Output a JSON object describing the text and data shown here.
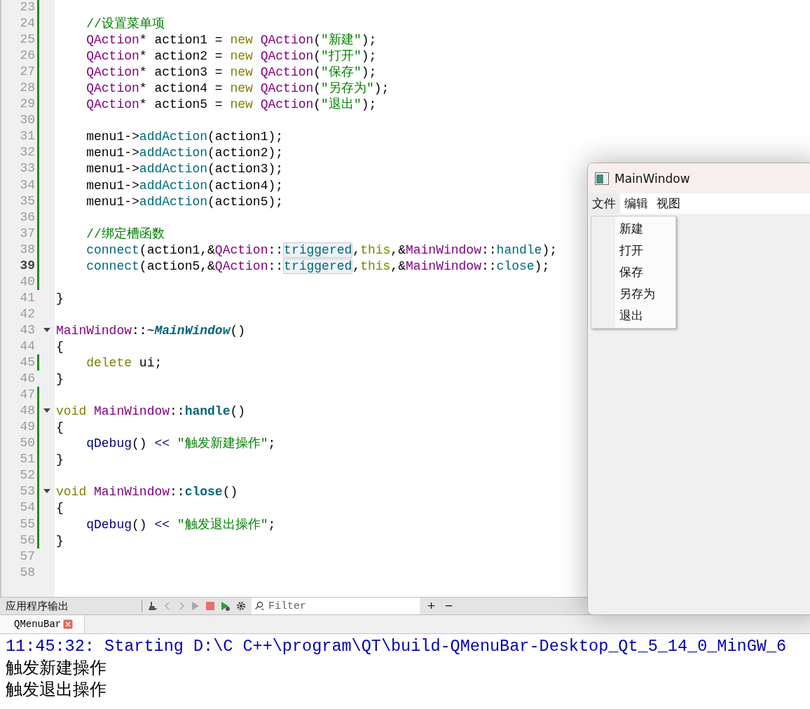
{
  "editor": {
    "lines": [
      {
        "number": "23",
        "changed": true,
        "fold": false,
        "current": false
      },
      {
        "number": "24",
        "changed": true,
        "fold": false,
        "current": false,
        "tokens": [
          {
            "kind": "comment",
            "text": "    //设置菜单项"
          }
        ]
      },
      {
        "number": "25",
        "changed": true,
        "fold": false,
        "current": false,
        "tokens": [
          {
            "kind": "type",
            "text": "    QAction"
          },
          {
            "kind": "plain",
            "text": "* action1 = "
          },
          {
            "kind": "keyword",
            "text": "new "
          },
          {
            "kind": "type",
            "text": "QAction"
          },
          {
            "kind": "plain",
            "text": "("
          },
          {
            "kind": "string",
            "text": "\"新建\""
          },
          {
            "kind": "plain",
            "text": ");"
          }
        ]
      },
      {
        "number": "26",
        "changed": true,
        "fold": false,
        "current": false,
        "tokens": [
          {
            "kind": "type",
            "text": "    QAction"
          },
          {
            "kind": "plain",
            "text": "* action2 = "
          },
          {
            "kind": "keyword",
            "text": "new "
          },
          {
            "kind": "type",
            "text": "QAction"
          },
          {
            "kind": "plain",
            "text": "("
          },
          {
            "kind": "string",
            "text": "\"打开\""
          },
          {
            "kind": "plain",
            "text": ");"
          }
        ]
      },
      {
        "number": "27",
        "changed": true,
        "fold": false,
        "current": false,
        "tokens": [
          {
            "kind": "type",
            "text": "    QAction"
          },
          {
            "kind": "plain",
            "text": "* action3 = "
          },
          {
            "kind": "keyword",
            "text": "new "
          },
          {
            "kind": "type",
            "text": "QAction"
          },
          {
            "kind": "plain",
            "text": "("
          },
          {
            "kind": "string",
            "text": "\"保存\""
          },
          {
            "kind": "plain",
            "text": ");"
          }
        ]
      },
      {
        "number": "28",
        "changed": true,
        "fold": false,
        "current": false,
        "tokens": [
          {
            "kind": "type",
            "text": "    QAction"
          },
          {
            "kind": "plain",
            "text": "* action4 = "
          },
          {
            "kind": "keyword",
            "text": "new "
          },
          {
            "kind": "type",
            "text": "QAction"
          },
          {
            "kind": "plain",
            "text": "("
          },
          {
            "kind": "string",
            "text": "\"另存为\""
          },
          {
            "kind": "plain",
            "text": ");"
          }
        ]
      },
      {
        "number": "29",
        "changed": true,
        "fold": false,
        "current": false,
        "tokens": [
          {
            "kind": "type",
            "text": "    QAction"
          },
          {
            "kind": "plain",
            "text": "* action5 = "
          },
          {
            "kind": "keyword",
            "text": "new "
          },
          {
            "kind": "type",
            "text": "QAction"
          },
          {
            "kind": "plain",
            "text": "("
          },
          {
            "kind": "string",
            "text": "\"退出\""
          },
          {
            "kind": "plain",
            "text": ");"
          }
        ]
      },
      {
        "number": "30",
        "changed": true,
        "fold": false,
        "current": false
      },
      {
        "number": "31",
        "changed": true,
        "fold": false,
        "current": false,
        "tokens": [
          {
            "kind": "plain",
            "text": "    menu1->"
          },
          {
            "kind": "function",
            "text": "addAction"
          },
          {
            "kind": "plain",
            "text": "(action1);"
          }
        ]
      },
      {
        "number": "32",
        "changed": true,
        "fold": false,
        "current": false,
        "tokens": [
          {
            "kind": "plain",
            "text": "    menu1->"
          },
          {
            "kind": "function",
            "text": "addAction"
          },
          {
            "kind": "plain",
            "text": "(action2);"
          }
        ]
      },
      {
        "number": "33",
        "changed": true,
        "fold": false,
        "current": false,
        "tokens": [
          {
            "kind": "plain",
            "text": "    menu1->"
          },
          {
            "kind": "function",
            "text": "addAction"
          },
          {
            "kind": "plain",
            "text": "(action3);"
          }
        ]
      },
      {
        "number": "34",
        "changed": true,
        "fold": false,
        "current": false,
        "tokens": [
          {
            "kind": "plain",
            "text": "    menu1->"
          },
          {
            "kind": "function",
            "text": "addAction"
          },
          {
            "kind": "plain",
            "text": "(action4);"
          }
        ]
      },
      {
        "number": "35",
        "changed": true,
        "fold": false,
        "current": false,
        "tokens": [
          {
            "kind": "plain",
            "text": "    menu1->"
          },
          {
            "kind": "function",
            "text": "addAction"
          },
          {
            "kind": "plain",
            "text": "(action5);"
          }
        ]
      },
      {
        "number": "36",
        "changed": true,
        "fold": false,
        "current": false
      },
      {
        "number": "37",
        "changed": true,
        "fold": false,
        "current": false,
        "tokens": [
          {
            "kind": "comment",
            "text": "    //绑定槽函数"
          }
        ]
      },
      {
        "number": "38",
        "changed": true,
        "fold": false,
        "current": false,
        "tokens": [
          {
            "kind": "function",
            "text": "    connect"
          },
          {
            "kind": "plain",
            "text": "(action1,&"
          },
          {
            "kind": "type",
            "text": "QAction"
          },
          {
            "kind": "plain",
            "text": "::"
          },
          {
            "kind": "highlight",
            "text": "triggered"
          },
          {
            "kind": "plain",
            "text": ","
          },
          {
            "kind": "keyword",
            "text": "this"
          },
          {
            "kind": "plain",
            "text": ",&"
          },
          {
            "kind": "type",
            "text": "MainWindow"
          },
          {
            "kind": "plain",
            "text": "::"
          },
          {
            "kind": "function",
            "text": "handle"
          },
          {
            "kind": "plain",
            "text": ");"
          }
        ]
      },
      {
        "number": "39",
        "changed": true,
        "fold": false,
        "current": true,
        "tokens": [
          {
            "kind": "function",
            "text": "    connect"
          },
          {
            "kind": "plain",
            "text": "(action5,&"
          },
          {
            "kind": "type",
            "text": "QAction"
          },
          {
            "kind": "plain",
            "text": "::"
          },
          {
            "kind": "highlight",
            "text": "triggered"
          },
          {
            "kind": "plain",
            "text": ","
          },
          {
            "kind": "keyword",
            "text": "this"
          },
          {
            "kind": "plain",
            "text": ",&"
          },
          {
            "kind": "type",
            "text": "MainWindow"
          },
          {
            "kind": "plain",
            "text": "::"
          },
          {
            "kind": "function",
            "text": "close"
          },
          {
            "kind": "plain",
            "text": ");"
          }
        ]
      },
      {
        "number": "40",
        "changed": true,
        "fold": false,
        "current": false
      },
      {
        "number": "41",
        "changed": false,
        "fold": false,
        "current": false,
        "tokens": [
          {
            "kind": "plain",
            "text": "}"
          }
        ]
      },
      {
        "number": "42",
        "changed": false,
        "fold": false,
        "current": false
      },
      {
        "number": "43",
        "changed": false,
        "fold": true,
        "current": false,
        "tokens": [
          {
            "kind": "type",
            "text": "MainWindow"
          },
          {
            "kind": "plain",
            "text": "::~"
          },
          {
            "kind": "italic",
            "text": "MainWindow"
          },
          {
            "kind": "plain",
            "text": "()"
          }
        ]
      },
      {
        "number": "44",
        "changed": false,
        "fold": false,
        "current": false,
        "tokens": [
          {
            "kind": "plain",
            "text": "{"
          }
        ]
      },
      {
        "number": "45",
        "changed": true,
        "fold": false,
        "current": false,
        "tokens": [
          {
            "kind": "keyword",
            "text": "    delete"
          },
          {
            "kind": "plain",
            "text": " ui;"
          }
        ]
      },
      {
        "number": "46",
        "changed": false,
        "fold": false,
        "current": false,
        "tokens": [
          {
            "kind": "plain",
            "text": "}"
          }
        ]
      },
      {
        "number": "47",
        "changed": true,
        "fold": false,
        "current": false
      },
      {
        "number": "48",
        "changed": true,
        "fold": true,
        "current": false,
        "tokens": [
          {
            "kind": "keyword",
            "text": "void "
          },
          {
            "kind": "type",
            "text": "MainWindow"
          },
          {
            "kind": "plain",
            "text": "::"
          },
          {
            "kind": "bold",
            "text": "handle"
          },
          {
            "kind": "plain",
            "text": "()"
          }
        ]
      },
      {
        "number": "49",
        "changed": true,
        "fold": false,
        "current": false,
        "tokens": [
          {
            "kind": "plain",
            "text": "{"
          }
        ]
      },
      {
        "number": "50",
        "changed": true,
        "fold": false,
        "current": false,
        "tokens": [
          {
            "kind": "call",
            "text": "    qDebug"
          },
          {
            "kind": "plain",
            "text": "() "
          },
          {
            "kind": "call",
            "text": "<< "
          },
          {
            "kind": "string",
            "text": "\"触发新建操作\""
          },
          {
            "kind": "plain",
            "text": ";"
          }
        ]
      },
      {
        "number": "51",
        "changed": true,
        "fold": false,
        "current": false,
        "tokens": [
          {
            "kind": "plain",
            "text": "}"
          }
        ]
      },
      {
        "number": "52",
        "changed": true,
        "fold": false,
        "current": false
      },
      {
        "number": "53",
        "changed": true,
        "fold": true,
        "current": false,
        "tokens": [
          {
            "kind": "keyword",
            "text": "void "
          },
          {
            "kind": "type",
            "text": "MainWindow"
          },
          {
            "kind": "plain",
            "text": "::"
          },
          {
            "kind": "bold",
            "text": "close"
          },
          {
            "kind": "plain",
            "text": "()"
          }
        ]
      },
      {
        "number": "54",
        "changed": true,
        "fold": false,
        "current": false,
        "tokens": [
          {
            "kind": "plain",
            "text": "{"
          }
        ]
      },
      {
        "number": "55",
        "changed": true,
        "fold": false,
        "current": false,
        "tokens": [
          {
            "kind": "call",
            "text": "    qDebug"
          },
          {
            "kind": "plain",
            "text": "() "
          },
          {
            "kind": "call",
            "text": "<< "
          },
          {
            "kind": "string",
            "text": "\"触发退出操作\""
          },
          {
            "kind": "plain",
            "text": ";"
          }
        ]
      },
      {
        "number": "56",
        "changed": true,
        "fold": false,
        "current": false,
        "tokens": [
          {
            "kind": "plain",
            "text": "}"
          }
        ]
      },
      {
        "number": "57",
        "changed": false,
        "fold": false,
        "current": false
      },
      {
        "number": "58",
        "changed": false,
        "fold": false,
        "current": false
      }
    ]
  },
  "output_pane": {
    "title": "应用程序输出",
    "filter": {
      "placeholder": "Filter"
    },
    "add": "+",
    "remove": "−",
    "tabs": [
      {
        "label": "QMenuBar",
        "selected": true
      }
    ],
    "lines": [
      {
        "kind": "status",
        "text": "11:45:32: Starting D:\\C C++\\program\\QT\\build-QMenuBar-Desktop_Qt_5_14_0_MinGW_6"
      },
      {
        "kind": "debug",
        "text": "触发新建操作"
      },
      {
        "kind": "debug",
        "text": "触发退出操作"
      }
    ]
  },
  "app_window": {
    "title": "MainWindow",
    "menu_bar": [
      {
        "label": "文件",
        "selected": true
      },
      {
        "label": "编辑",
        "selected": false
      },
      {
        "label": "视图",
        "selected": false
      }
    ],
    "menu_items": [
      "新建",
      "打开",
      "保存",
      "另存为",
      "退出"
    ]
  }
}
